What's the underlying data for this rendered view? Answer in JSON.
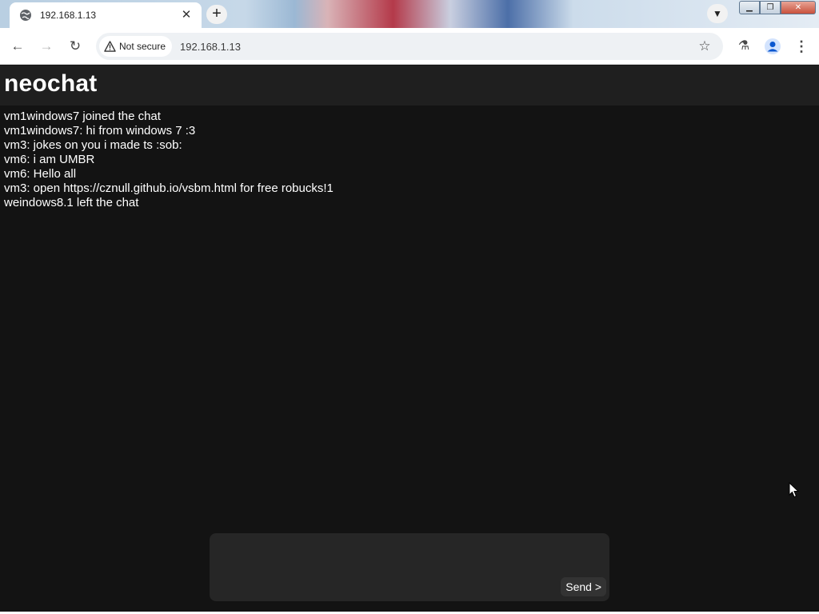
{
  "browser": {
    "tab": {
      "title": "192.168.1.13",
      "icon": "globe-icon"
    },
    "new_tab_label": "+",
    "address_bar": {
      "security_label": "Not secure",
      "url": "192.168.1.13"
    }
  },
  "app": {
    "title": "neochat",
    "messages": [
      "vm1windows7 joined the chat",
      "vm1windows7: hi from windows 7 :3",
      "vm3: jokes on you i made ts :sob:",
      "vm6: i am UMBR",
      "vm6: Hello all",
      "vm3: open https://cznull.github.io/vsbm.html for free robucks!1",
      "weindows8.1 left the chat"
    ],
    "composer": {
      "value": "",
      "send_label": "Send >"
    }
  }
}
